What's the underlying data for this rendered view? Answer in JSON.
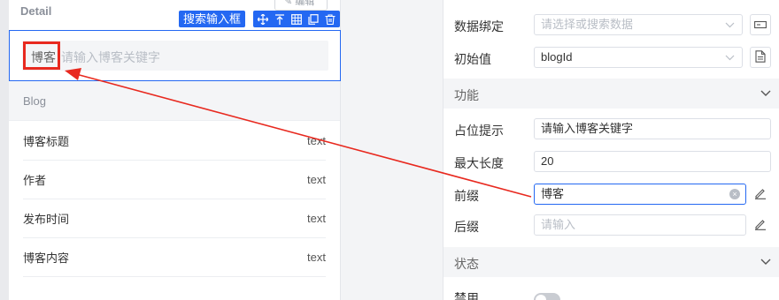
{
  "canvas": {
    "detail_title": "Detail",
    "edit_label": "✎ 编辑",
    "toolbar": {
      "component_name": "搜索输入框"
    },
    "search": {
      "prefix": "博客",
      "placeholder": "请输入博客关键字"
    },
    "section_title": "Blog",
    "fields": [
      {
        "name": "博客标题",
        "type": "text"
      },
      {
        "name": "作者",
        "type": "text"
      },
      {
        "name": "发布时间",
        "type": "text"
      },
      {
        "name": "博客内容",
        "type": "text"
      }
    ]
  },
  "props": {
    "data_binding": {
      "label": "数据绑定",
      "placeholder": "请选择或搜索数据"
    },
    "initial_value": {
      "label": "初始值",
      "value": "blogId"
    },
    "group_function": {
      "title": "功能"
    },
    "placeholder_prop": {
      "label": "占位提示",
      "value": "请输入博客关键字"
    },
    "max_length": {
      "label": "最大长度",
      "value": "20"
    },
    "prefix": {
      "label": "前缀",
      "value": "博客"
    },
    "suffix": {
      "label": "后缀",
      "placeholder": "请输入"
    },
    "group_status": {
      "title": "状态"
    },
    "disabled": {
      "label": "禁用",
      "on": false
    }
  },
  "colors": {
    "accent": "#2468f2",
    "highlight_red": "#e8291f"
  }
}
